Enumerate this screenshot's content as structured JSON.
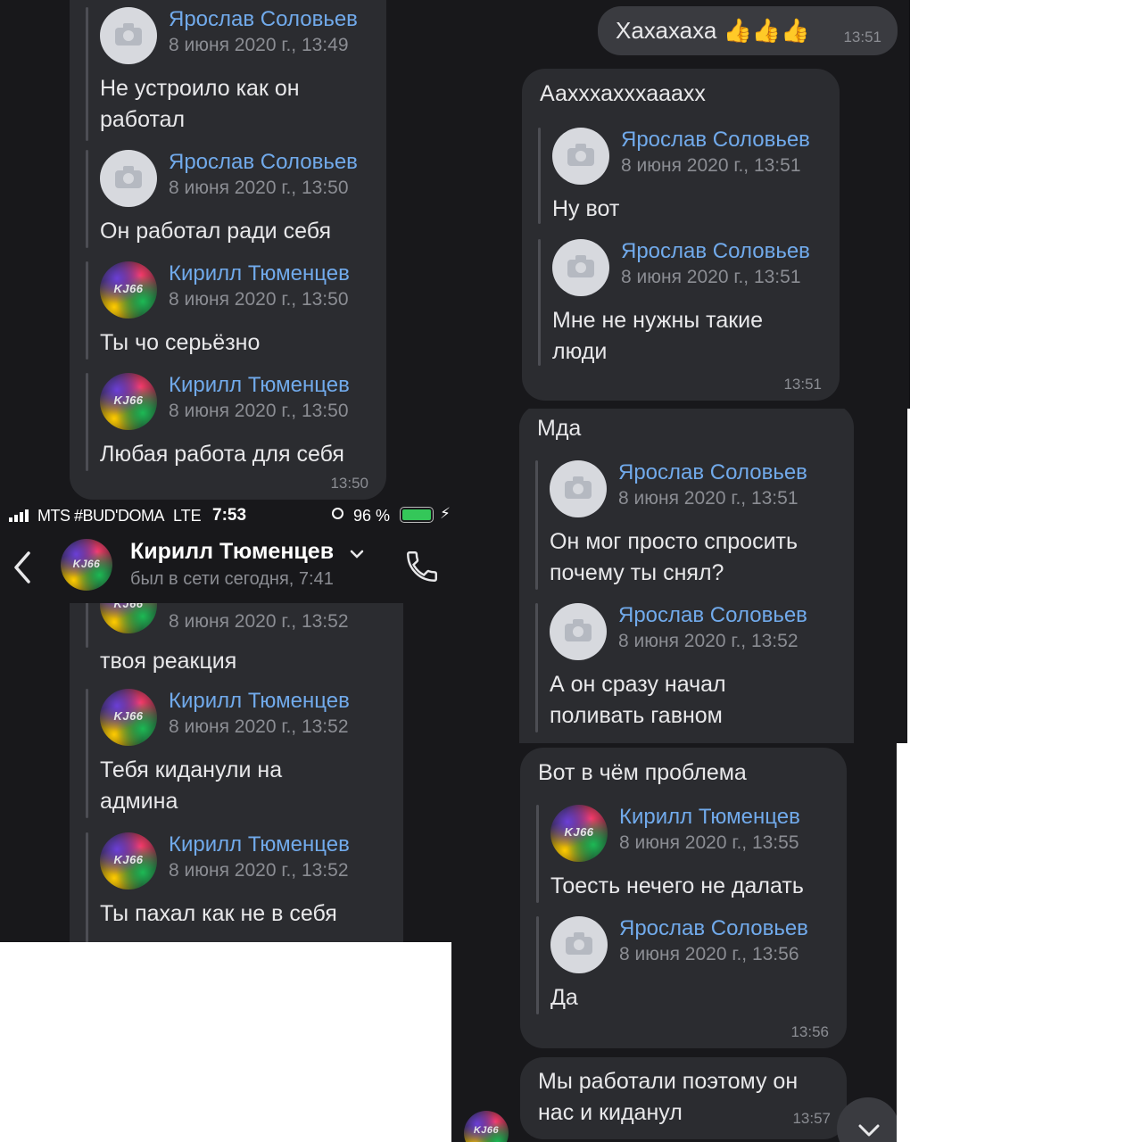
{
  "left_top": {
    "messages": [
      {
        "avatar": "camera-icon",
        "name": "Ярослав Соловьев",
        "date": "8 июня 2020 г., 13:49",
        "text": [
          "Не устроило как он",
          "работал"
        ]
      },
      {
        "avatar": "camera-icon",
        "name": "Ярослав Соловьев",
        "date": "8 июня 2020 г., 13:50",
        "text": [
          "Он работал ради себя"
        ]
      },
      {
        "avatar": "user-avatar",
        "name": "Кирилл Тюменцев",
        "date": "8 июня 2020 г., 13:50",
        "text": [
          "Ты чо серьёзно"
        ]
      },
      {
        "avatar": "user-avatar",
        "name": "Кирилл Тюменцев",
        "date": "8 июня 2020 г., 13:50",
        "text": [
          "Любая работа для себя"
        ]
      }
    ],
    "time": "13:50"
  },
  "status_bar": {
    "carrier": "MTS #BUD'DOMA",
    "network": "LTE",
    "clock": "7:53",
    "battery": "96 %"
  },
  "header": {
    "contact_name": "Кирилл Тюменцев",
    "last_seen": "был в сети сегодня, 7:41",
    "avatar_text": "KJ66"
  },
  "left_bottom": {
    "messages": [
      {
        "date": "8 июня 2020 г., 13:52",
        "text": [
          "твоя реакция"
        ]
      },
      {
        "name": "Кирилл Тюменцев",
        "date": "8 июня 2020 г., 13:52",
        "text": [
          "Тебя киданули на",
          "админа"
        ]
      },
      {
        "name": "Кирилл Тюменцев",
        "date": "8 июня 2020 г., 13:52",
        "text": [
          "Ты пахал как не в себя"
        ]
      }
    ]
  },
  "right": {
    "own_message": {
      "text": "Хахахаха 👍👍👍",
      "time": "13:51"
    },
    "bubble1": {
      "text": "Аахххахххааахх",
      "forwards": [
        {
          "name": "Ярослав Соловьев",
          "date": "8 июня 2020 г., 13:51",
          "text": [
            "Ну вот"
          ]
        },
        {
          "name": "Ярослав Соловьев",
          "date": "8 июня 2020 г., 13:51",
          "text": [
            "Мне не нужны такие",
            "люди"
          ]
        }
      ],
      "time": "13:51"
    },
    "bubble2": {
      "text": "Мда",
      "forwards": [
        {
          "name": "Ярослав Соловьев",
          "date": "8 июня 2020 г., 13:51",
          "text": [
            "Он мог просто спросить",
            "почему ты снял?"
          ]
        },
        {
          "name": "Ярослав Соловьев",
          "date": "8 июня 2020 г., 13:52",
          "text": [
            "А он сразу начал",
            "поливать гавном"
          ]
        }
      ]
    },
    "bubble3": {
      "text": "Вот в чём проблема",
      "forwards": [
        {
          "name": "Кирилл Тюменцев",
          "date": "8 июня 2020 г., 13:55",
          "text": [
            "Тоесть нечего не далать"
          ]
        },
        {
          "name": "Ярослав Соловьев",
          "date": "8 июня 2020 г., 13:56",
          "text": [
            "Да"
          ]
        }
      ],
      "time": "13:56"
    },
    "bubble4": {
      "text": [
        "Мы работали поэтому он",
        "нас и киданул"
      ],
      "time": "13:57"
    }
  },
  "colors": {
    "background": "#18181b",
    "bubble": "#2b2c30",
    "link": "#71aaeb",
    "meta": "#8b8d93",
    "battery": "#34c759"
  }
}
